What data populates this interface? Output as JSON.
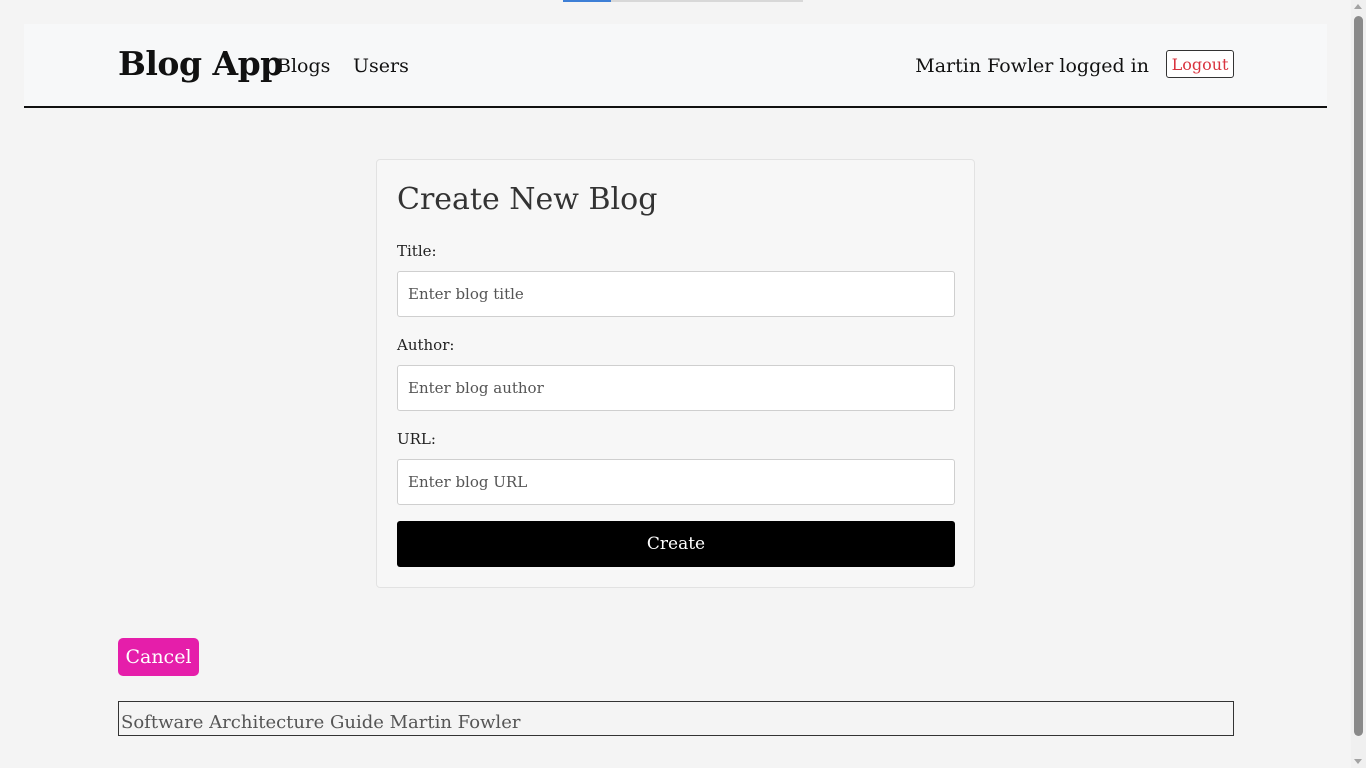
{
  "navbar": {
    "brand": "Blog App",
    "links": [
      "Blogs",
      "Users"
    ],
    "logged_in_text": "Martin Fowler logged in",
    "logout_label": "Logout"
  },
  "form": {
    "title": "Create New Blog",
    "fields": [
      {
        "label": "Title:",
        "placeholder": "Enter blog title",
        "value": ""
      },
      {
        "label": "Author:",
        "placeholder": "Enter blog author",
        "value": ""
      },
      {
        "label": "URL:",
        "placeholder": "Enter blog URL",
        "value": ""
      }
    ],
    "submit_label": "Create"
  },
  "cancel_label": "Cancel",
  "blogs": [
    {
      "text": "Software Architecture Guide Martin Fowler"
    }
  ],
  "colors": {
    "background": "#f4f4f4",
    "cancel": "#e51eaa",
    "logout_text": "#d9343f",
    "create_button": "#000000"
  }
}
